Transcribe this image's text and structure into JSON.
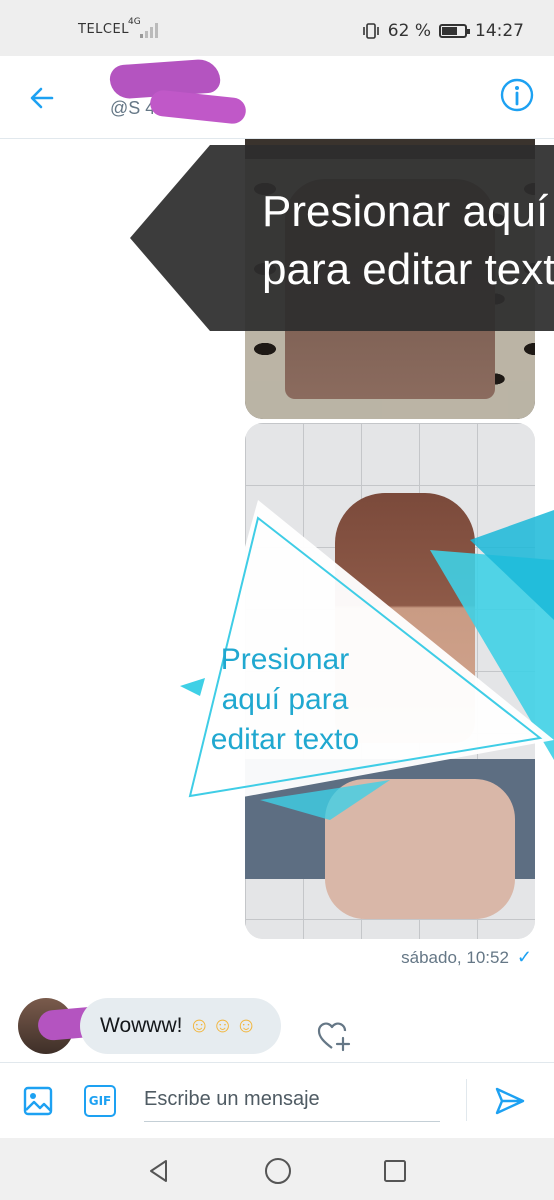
{
  "status_bar": {
    "carrier": "TELCEL",
    "network": "4G",
    "battery_percent": "62 %",
    "battery_level": 0.62,
    "time": "14:27"
  },
  "header": {
    "username": "@S 499",
    "back_icon": "arrow-left-icon",
    "info_icon": "info-icon"
  },
  "conversation": {
    "timestamp": "sábado, 10:52",
    "read_icon": "checkmark-icon",
    "incoming_message": {
      "text": "Wowww!",
      "emoji": "☺☺☺"
    },
    "reaction_icon": "heart-plus-icon"
  },
  "overlay": {
    "dark_text_line1": "Presionar aquí",
    "dark_text_line2": "para editar texto",
    "light_text": "Presionar aquí para editar texto"
  },
  "composer": {
    "image_icon": "image-icon",
    "gif_label": "GIF",
    "placeholder": "Escribe un mensaje",
    "send_icon": "send-icon"
  },
  "nav_bar": {
    "back_icon": "triangle-back-icon",
    "home_icon": "circle-home-icon",
    "recent_icon": "square-recents-icon"
  },
  "colors": {
    "accent": "#1da1f2",
    "bubble": "#e6ecf0",
    "muted_text": "#657786",
    "overlay_cyan": "#3fd0e6"
  }
}
